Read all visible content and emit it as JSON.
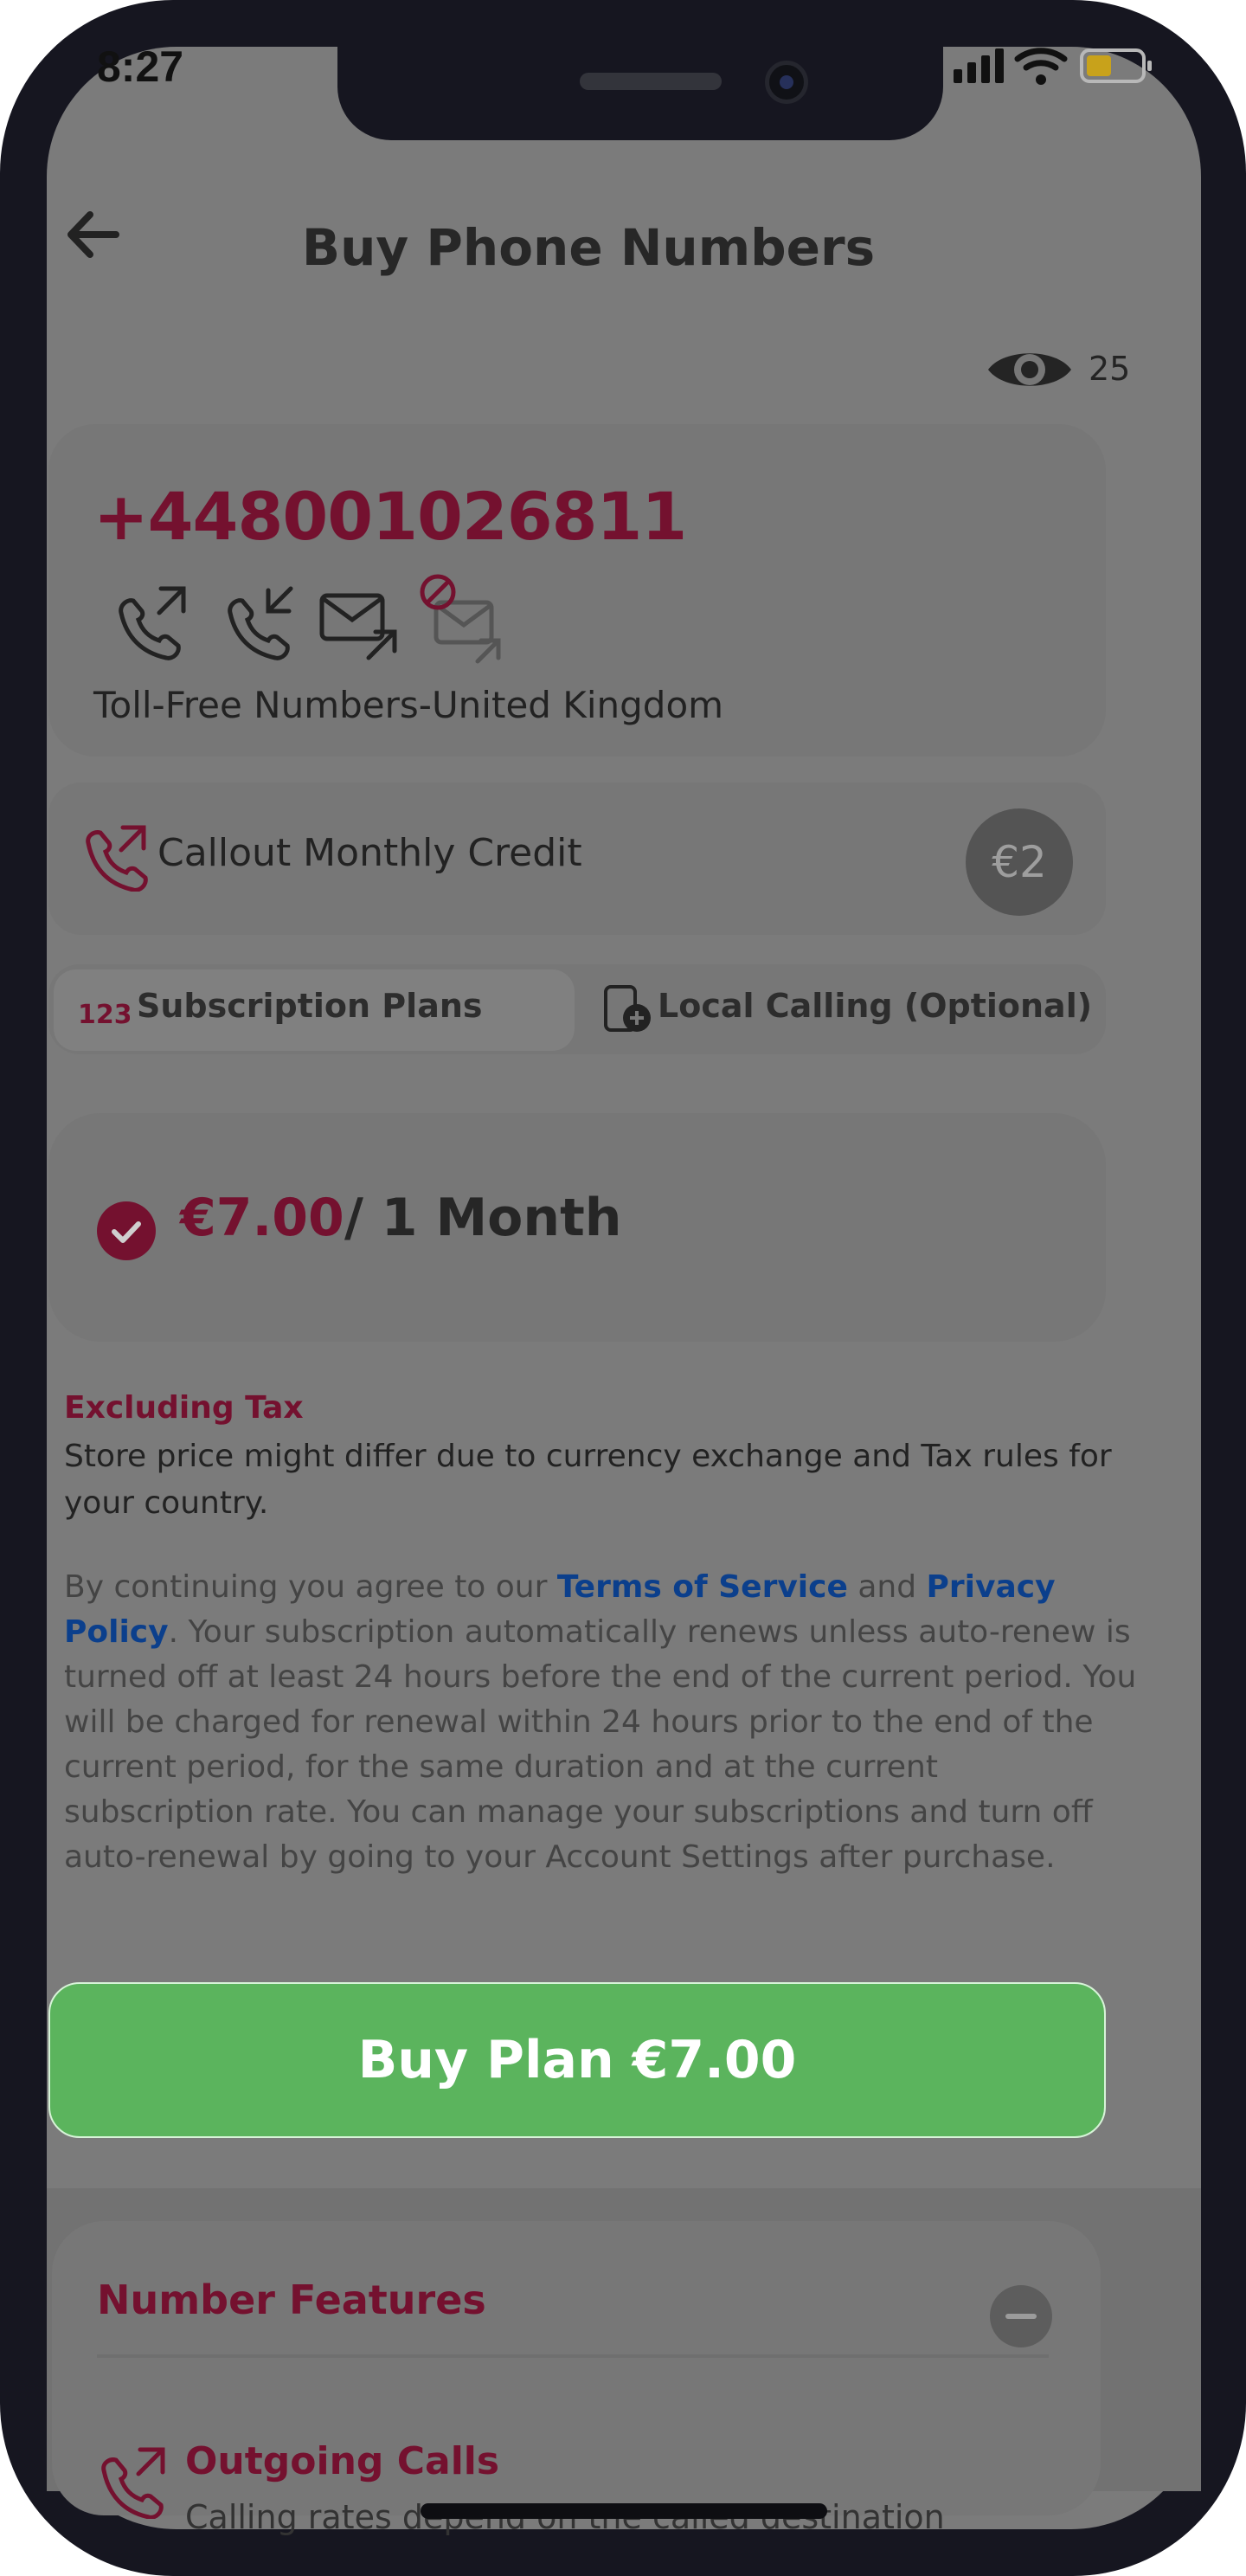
{
  "status_bar": {
    "time": "8:27"
  },
  "header": {
    "title": "Buy Phone Numbers",
    "views_count": "25"
  },
  "number_card": {
    "phone_number": "+448001026811",
    "type": "Toll-Free Numbers-United Kingdom",
    "feature_icons": [
      "outgoing-call-icon",
      "incoming-call-icon",
      "sms-outgoing-icon",
      "sms-disabled-icon"
    ]
  },
  "credit": {
    "label": "Callout Monthly Credit",
    "badge": "€2"
  },
  "tabs": [
    {
      "label": "Subscription Plans",
      "icon": "123-icon"
    },
    {
      "label": "Local Calling (Optional)",
      "icon": "calendar-add-icon"
    }
  ],
  "plan": {
    "price": "€7.00",
    "duration": "/ 1 Month"
  },
  "tax": {
    "title": "Excluding Tax",
    "note": "Store price might differ due to currency exchange and Tax rules for your country."
  },
  "terms": {
    "prefix": "By continuing you agree to our",
    "tos": "Terms of Service",
    "and": "and",
    "privacy": "Privacy Policy",
    "suffix": ". Your subscription automatically renews unless auto-renew is turned off at least 24 hours before the end of the current period. You will be charged for renewal within 24 hours prior to the end of the current period, for the same duration and at the current subscription rate. You can manage your subscriptions and turn off auto-renewal by going to your Account Settings after purchase."
  },
  "buy_button": {
    "label": "Buy Plan €7.00"
  },
  "features": {
    "title": "Number Features",
    "items": [
      {
        "title": "Outgoing Calls",
        "desc": "Calling rates depend on the called destination"
      }
    ]
  },
  "colors": {
    "accent": "#74112f",
    "buy_button": "#5bb45d",
    "overlay": "#7b7b7b",
    "frame": "#161620"
  }
}
